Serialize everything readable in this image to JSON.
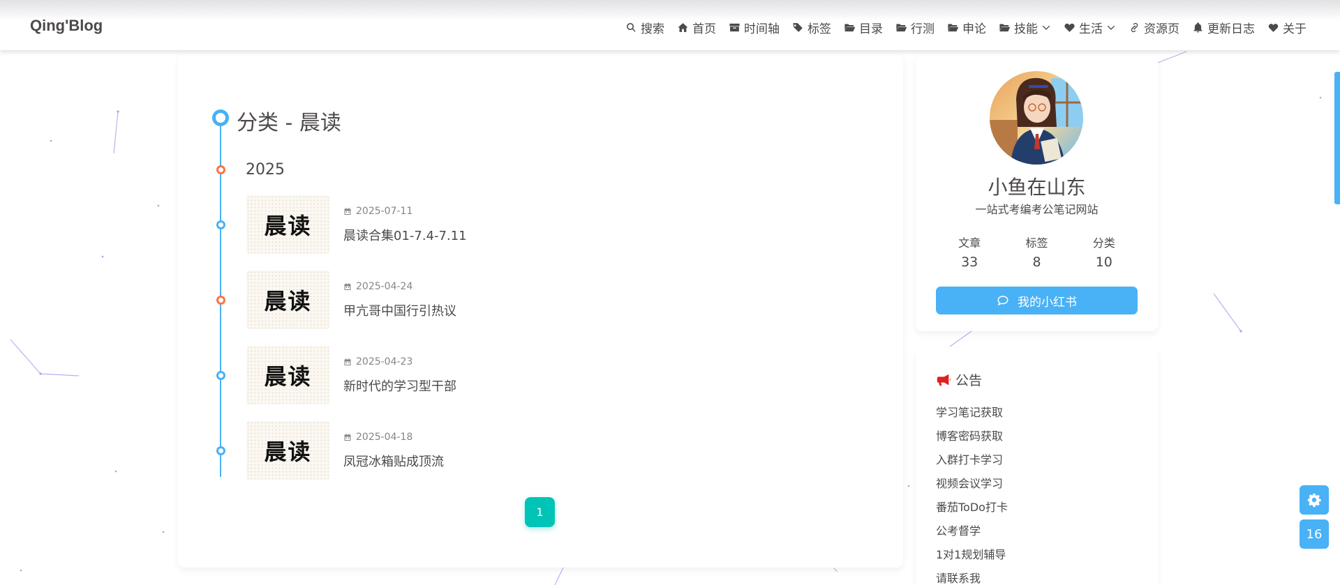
{
  "brand": "Qing'Blog",
  "nav": [
    {
      "label": "搜索",
      "icon": "search-icon",
      "caret": false
    },
    {
      "label": "首页",
      "icon": "home-icon",
      "caret": false
    },
    {
      "label": "时间轴",
      "icon": "archive-icon",
      "caret": false
    },
    {
      "label": "标签",
      "icon": "tags-icon",
      "caret": false
    },
    {
      "label": "目录",
      "icon": "folder-open-icon",
      "caret": false
    },
    {
      "label": "行测",
      "icon": "folder-open-icon",
      "caret": false
    },
    {
      "label": "申论",
      "icon": "folder-open-icon",
      "caret": false
    },
    {
      "label": "技能",
      "icon": "folder-open-icon",
      "caret": true
    },
    {
      "label": "生活",
      "icon": "heartbeat-icon",
      "caret": true
    },
    {
      "label": "资源页",
      "icon": "link-icon",
      "caret": false
    },
    {
      "label": "更新日志",
      "icon": "bell-icon",
      "caret": false
    },
    {
      "label": "关于",
      "icon": "heart-icon",
      "caret": false
    }
  ],
  "main": {
    "title": "分类 - 晨读",
    "year": "2025",
    "thumb_text": "晨读",
    "posts": [
      {
        "date": "2025-07-11",
        "title": "晨读合集01-7.4-7.11",
        "dot": "blue"
      },
      {
        "date": "2025-04-24",
        "title": "甲亢哥中国行引热议",
        "dot": "orange"
      },
      {
        "date": "2025-04-23",
        "title": "新时代的学习型干部",
        "dot": "blue"
      },
      {
        "date": "2025-04-18",
        "title": "凤冠冰箱贴成顶流",
        "dot": "blue"
      }
    ],
    "page": "1"
  },
  "author": {
    "name": "小鱼在山东",
    "description": "一站式考编考公笔记网站",
    "stats": [
      {
        "label": "文章",
        "value": "33"
      },
      {
        "label": "标签",
        "value": "8"
      },
      {
        "label": "分类",
        "value": "10"
      }
    ],
    "button_label": "我的小红书"
  },
  "notice": {
    "title": "公告",
    "items": [
      "学习笔记获取",
      "博客密码获取",
      "入群打卡学习",
      "视频会议学习",
      "番茄ToDo打卡",
      "公考督学",
      "1对1规划辅导",
      "请联系我"
    ]
  },
  "float": {
    "settings_icon": "gear-icon",
    "reading_percent": "16"
  },
  "colors": {
    "accent": "#49b1f5",
    "timeline_orange": "#ff7242",
    "pagination": "#00c4b6",
    "notice_icon": "#e02020"
  }
}
